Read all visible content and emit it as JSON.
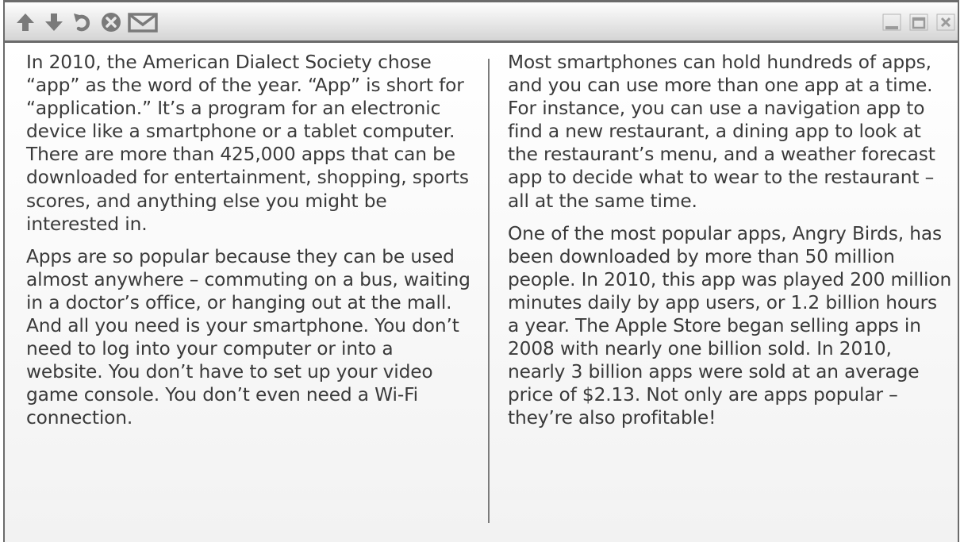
{
  "toolbar": {
    "icons": [
      "up-arrow-icon",
      "down-arrow-icon",
      "undo-icon",
      "close-circle-icon",
      "mail-icon"
    ],
    "window_controls": [
      "minimize-icon",
      "maximize-icon",
      "close-icon"
    ]
  },
  "columns": {
    "left": [
      "In 2010, the American Dialect Society chose “app” as the word of the year. “App” is short for “application.” It’s a program for an electronic device like a smartphone or a tablet computer. There are more than 425,000 apps that can be downloaded for entertainment, shopping, sports scores, and anything else you might be interested in.",
      "Apps are so popular because they can be used almost anywhere – commuting on a bus, waiting in a doctor’s office, or hanging out at the mall. And all you need is your smartphone. You don’t need to log into your computer or into a website. You don’t have to set up your video game console. You don’t even need a Wi-Fi connection."
    ],
    "right": [
      "Most smartphones can hold hundreds of apps, and you can use more than one app at a time. For instance, you can use a navigation app to find a new restaurant, a dining app to look at the restaurant’s menu, and a weather forecast app to decide what to wear to the restaurant – all at the same time.",
      "One of the most popular apps, Angry Birds, has been downloaded by more than 50 million people. In 2010, this app was played 200 million minutes daily by app users, or 1.2 billion hours a year. The Apple Store began selling apps in 2008 with nearly one billion sold. In 2010, nearly 3 billion apps were sold at an average price of $2.13. Not only are apps popular – they’re also profitable!"
    ]
  }
}
